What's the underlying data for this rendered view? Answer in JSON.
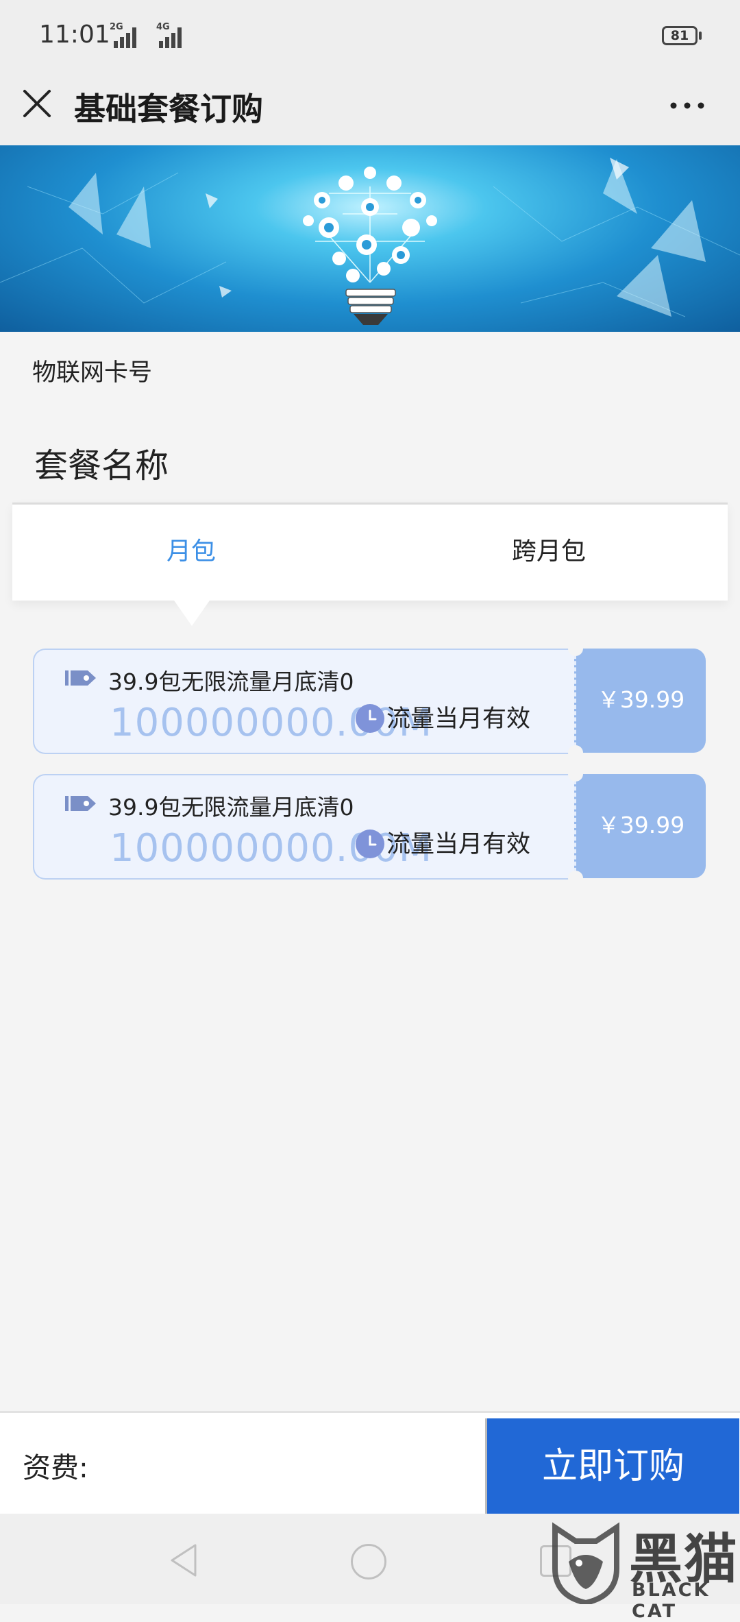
{
  "status_bar": {
    "time": "11:01",
    "signal_1": "2G",
    "signal_2": "4G",
    "battery": "81"
  },
  "header": {
    "title": "基础套餐订购",
    "close_icon": "close-icon",
    "more_icon": "more-icon"
  },
  "banner": {
    "image": "lightbulb-network-banner"
  },
  "form": {
    "card_number_label": "物联网卡号",
    "plan_name_label": "套餐名称"
  },
  "tabs": [
    {
      "label": "月包",
      "active": true
    },
    {
      "label": "跨月包",
      "active": false
    }
  ],
  "plans": [
    {
      "title": "39.9包无限流量月底清0",
      "data": "100000000.00M",
      "validity": "流量当月有效",
      "price": "￥39.99"
    },
    {
      "title": "39.9包无限流量月底清0",
      "data": "100000000.00M",
      "validity": "流量当月有效",
      "price": "￥39.99"
    }
  ],
  "bottom_bar": {
    "fee_label": "资费:",
    "order_button": "立即订购"
  },
  "watermark": {
    "logo_text": "黑猫",
    "brand_text": "BLACK CAT"
  },
  "colors": {
    "accent_blue": "#3b8fe6",
    "button_blue": "#2168d6",
    "price_panel": "#97b9ec",
    "card_bg": "#eef3fd"
  }
}
